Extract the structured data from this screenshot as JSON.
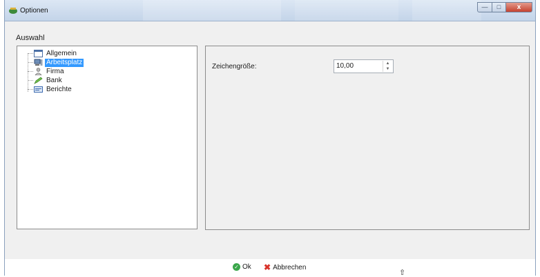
{
  "window": {
    "title": "Optionen",
    "controls": {
      "minimize": "—",
      "maximize": "□",
      "close": "x"
    }
  },
  "tree": {
    "group_label": "Auswahl",
    "items": [
      {
        "label": "Allgemein",
        "icon": "window-icon"
      },
      {
        "label": "Arbeitsplatz",
        "icon": "computer-icon",
        "selected": true
      },
      {
        "label": "Firma",
        "icon": "person-icon"
      },
      {
        "label": "Bank",
        "icon": "pencil-icon"
      },
      {
        "label": "Berichte",
        "icon": "report-icon"
      }
    ]
  },
  "settings": {
    "font_size_label": "Zeichengröße:",
    "font_size_value": "10,00",
    "spin_up": "▲",
    "spin_down": "▼"
  },
  "footer": {
    "ok_label": "Ok",
    "cancel_label": "Abbrechen",
    "ok_glyph": "✓",
    "cancel_glyph": "✖"
  },
  "colors": {
    "selection": "#3399ff",
    "ok_green": "#3aa64a",
    "cancel_red": "#d8332b",
    "titlebar": "#c3d4e9"
  }
}
